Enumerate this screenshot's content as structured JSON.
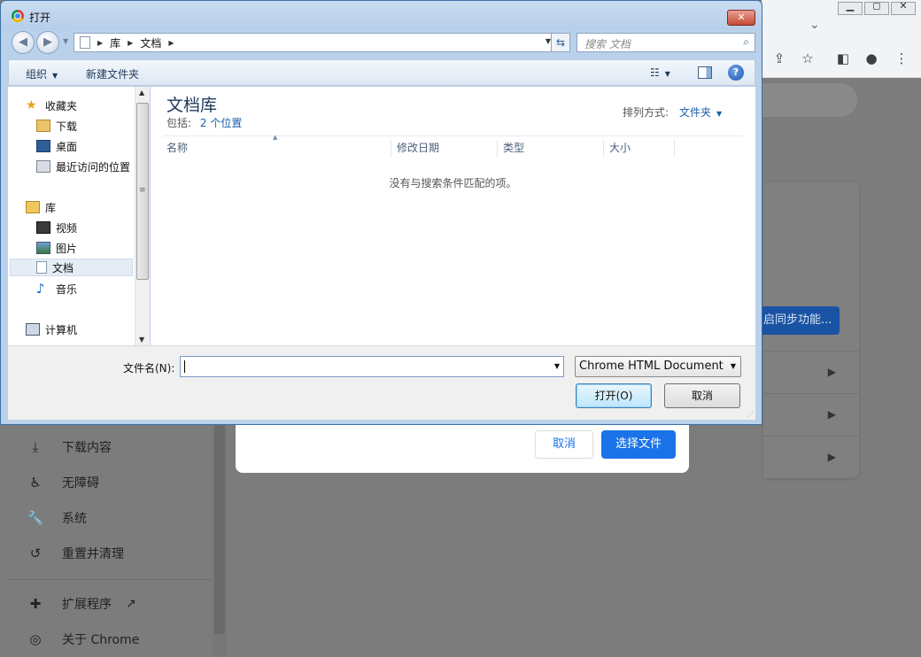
{
  "dialog": {
    "title": "打开",
    "address": {
      "crumbs": [
        "库",
        "文档"
      ]
    },
    "search_placeholder": "搜索 文档",
    "toolbar": {
      "organize": "组织",
      "new_folder": "新建文件夹"
    },
    "nav": {
      "favorites": "收藏夹",
      "items": [
        "下载",
        "桌面",
        "最近访问的位置"
      ],
      "libraries": "库",
      "lib_items": [
        "视频",
        "图片",
        "文档",
        "音乐"
      ],
      "computer": "计算机"
    },
    "library": {
      "title": "文档库",
      "includes_label": "包括:",
      "includes_link": "2 个位置",
      "arrange_label": "排列方式:",
      "arrange_value": "文件夹"
    },
    "columns": [
      "名称",
      "修改日期",
      "类型",
      "大小"
    ],
    "empty_message": "没有与搜索条件匹配的项。",
    "filename_label": "文件名(N):",
    "filename_value": "",
    "filetype_value": "Chrome HTML Document",
    "open_button": "打开(O)",
    "cancel_button": "取消"
  },
  "chrome": {
    "sync_button": "启同步功能...",
    "sidebar": [
      {
        "label": "下载内容",
        "icon": "download-icon"
      },
      {
        "label": "无障碍",
        "icon": "accessibility-icon"
      },
      {
        "label": "系统",
        "icon": "wrench-icon"
      },
      {
        "label": "重置并清理",
        "icon": "restore-icon"
      },
      {
        "label": "扩展程序",
        "icon": "puzzle-icon"
      },
      {
        "label": "关于 Chrome",
        "icon": "chrome-icon"
      }
    ],
    "dialog_cancel": "取消",
    "dialog_choose": "选择文件"
  },
  "colors": {
    "accent": "#1a73e8",
    "title_blue": "#1e395b",
    "link_blue": "#1a5ea9"
  }
}
